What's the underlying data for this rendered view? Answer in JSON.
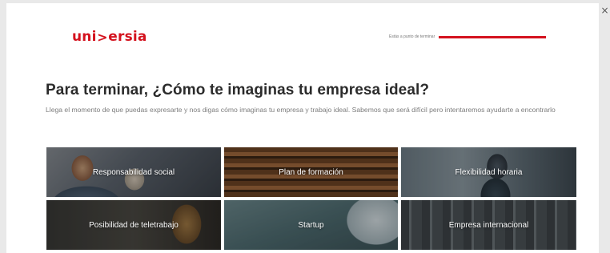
{
  "close": {
    "glyph": "×"
  },
  "logo": {
    "part1": "uni",
    "part2": ">",
    "part3": "ersia",
    "color": "#d4121e"
  },
  "progress": {
    "label": "Estás a punto de terminar",
    "fill_fraction": 1.0,
    "color": "#d4121e"
  },
  "heading": "Para terminar, ¿Cómo te imaginas tu empresa ideal?",
  "description": "Llega el momento de que puedas expresarte y nos digas cómo imaginas tu empresa y trabajo ideal. Sabemos que será difícil pero intentaremos ayudarte a encontrarlo",
  "options": [
    {
      "label": "Responsabilidad social"
    },
    {
      "label": "Plan de formación"
    },
    {
      "label": "Flexibilidad horaria"
    },
    {
      "label": "Posibilidad de teletrabajo"
    },
    {
      "label": "Startup"
    },
    {
      "label": "Empresa internacional"
    }
  ]
}
